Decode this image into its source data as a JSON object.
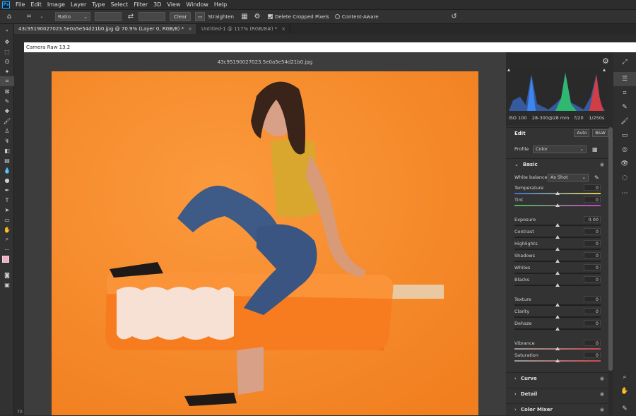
{
  "menubar": {
    "logo": "Ps",
    "items": [
      "File",
      "Edit",
      "Image",
      "Layer",
      "Type",
      "Select",
      "Filter",
      "3D",
      "View",
      "Window",
      "Help"
    ]
  },
  "options": {
    "ratio": "Ratio",
    "clear": "Clear",
    "straighten": "Straighten",
    "delete_cropped": "Delete Cropped Pixels",
    "content_aware": "Content-Aware"
  },
  "tabs": [
    {
      "label": "43c95190027023.5e0a5e54d21b0.jpg @ 70.9% (Layer 0, RGB/8) *",
      "close": "×"
    },
    {
      "label": "Untitled-1 @ 117% (RGB/8#) *",
      "close": "×"
    }
  ],
  "camera_raw": {
    "title": "Camera Raw 13.2",
    "filename": "43c95190027023.5e0a5e54d21b0.jpg",
    "exif": {
      "iso": "ISO 100",
      "lens": "28-300@28 mm",
      "aperture": "f/20",
      "shutter": "1/250s"
    },
    "edit": {
      "label": "Edit",
      "auto": "Auto",
      "bw": "B&W"
    },
    "profile": {
      "label": "Profile",
      "value": "Color"
    },
    "basic": {
      "label": "Basic",
      "white_balance_label": "White balance",
      "white_balance_value": "As Shot",
      "sliders": [
        {
          "label": "Temperature",
          "value": "0",
          "position": 0.5,
          "type": "temp"
        },
        {
          "label": "Tint",
          "value": "0",
          "position": 0.5,
          "type": "tint"
        },
        {
          "label": "Exposure",
          "value": "0.00",
          "position": 0.5,
          "type": "plain"
        },
        {
          "label": "Contrast",
          "value": "0",
          "position": 0.5,
          "type": "plain"
        },
        {
          "label": "Highlights",
          "value": "0",
          "position": 0.5,
          "type": "plain"
        },
        {
          "label": "Shadows",
          "value": "0",
          "position": 0.5,
          "type": "plain"
        },
        {
          "label": "Whites",
          "value": "0",
          "position": 0.5,
          "type": "plain"
        },
        {
          "label": "Blacks",
          "value": "0",
          "position": 0.5,
          "type": "plain"
        },
        {
          "label": "Texture",
          "value": "0",
          "position": 0.5,
          "type": "plain"
        },
        {
          "label": "Clarity",
          "value": "0",
          "position": 0.5,
          "type": "plain"
        },
        {
          "label": "Dehaze",
          "value": "0",
          "position": 0.5,
          "type": "plain"
        },
        {
          "label": "Vibrance",
          "value": "0",
          "position": 0.5,
          "type": "vib"
        },
        {
          "label": "Saturation",
          "value": "0",
          "position": 0.5,
          "type": "vib"
        }
      ]
    },
    "sections": [
      "Curve",
      "Detail",
      "Color Mixer"
    ]
  },
  "status": {
    "zoom": "70"
  },
  "colors": {
    "accent": "#31a8ff",
    "photo_bg": "#f88a2c",
    "panel": "#333333"
  }
}
